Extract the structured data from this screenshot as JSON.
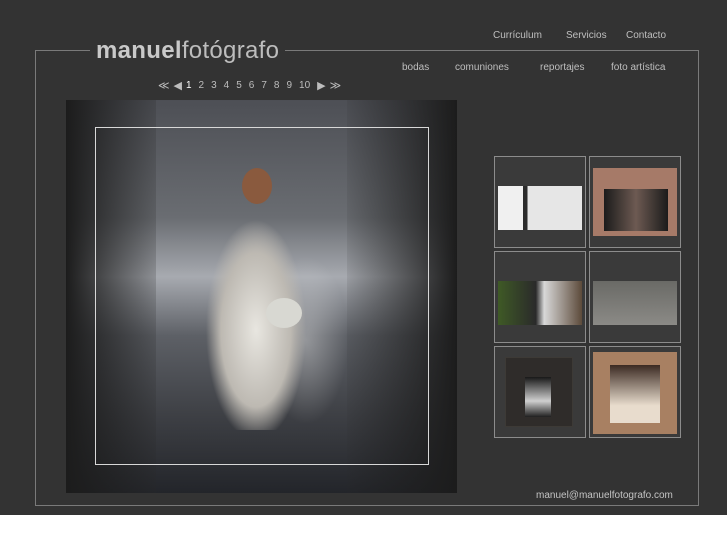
{
  "logo": {
    "bold": "manuel",
    "light": "fotógrafo"
  },
  "top_nav": [
    {
      "label": "Currículum"
    },
    {
      "label": "Servicios"
    },
    {
      "label": "Contacto"
    }
  ],
  "sub_nav": [
    {
      "label": "bodas"
    },
    {
      "label": "comuniones"
    },
    {
      "label": "reportajes"
    },
    {
      "label": "foto artística"
    }
  ],
  "pager": {
    "first": "≪",
    "prev": "◀",
    "pages": [
      "1",
      "2",
      "3",
      "4",
      "5",
      "6",
      "7",
      "8",
      "9",
      "10"
    ],
    "current": "1",
    "next": "▶",
    "last": "≫"
  },
  "thumbnails": [
    {
      "subject": "album-collage"
    },
    {
      "subject": "portrait-woman"
    },
    {
      "subject": "couple-garden"
    },
    {
      "subject": "couple-plaza"
    },
    {
      "subject": "bride-bw-framed"
    },
    {
      "subject": "bride-sepia"
    }
  ],
  "footer": {
    "email": "manuel@manuelfotografo.com"
  },
  "colors": {
    "background": "#333333",
    "text": "#bfbfbf",
    "border": "#7a7a7a"
  }
}
